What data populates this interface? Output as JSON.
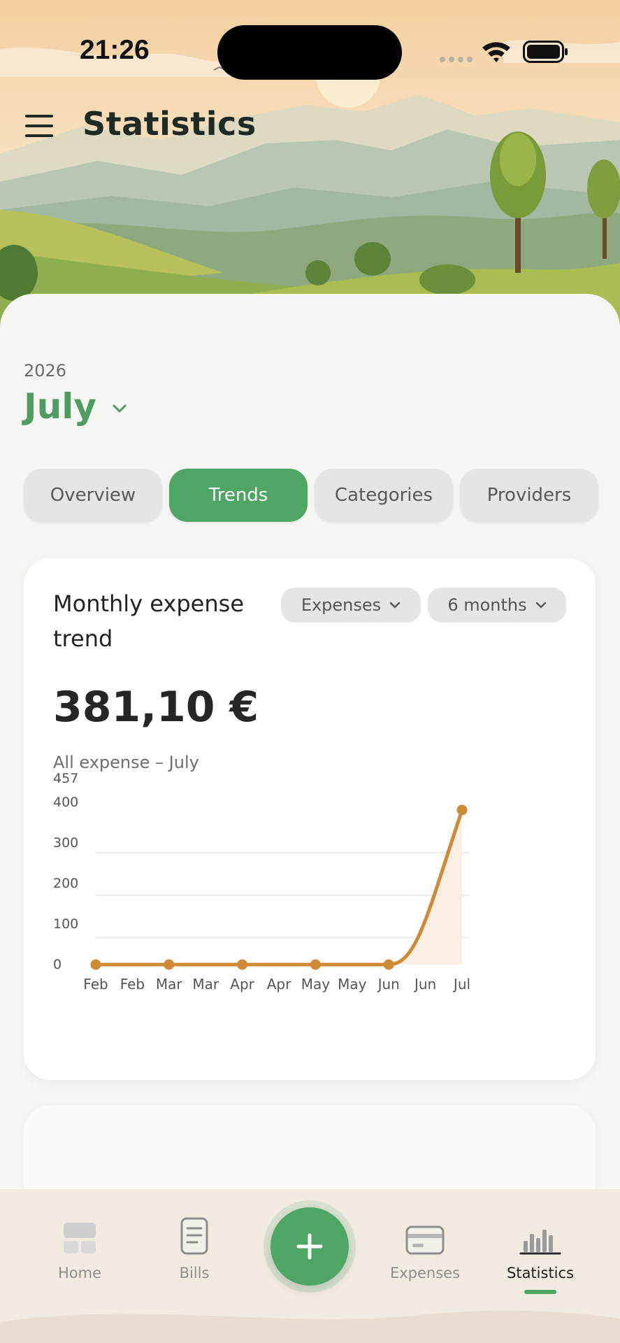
{
  "status_bar": {
    "time": "21:26"
  },
  "header": {
    "title": "Statistics"
  },
  "period": {
    "year": "2026",
    "month": "July"
  },
  "tabs": [
    {
      "label": "Overview",
      "active": false
    },
    {
      "label": "Trends",
      "active": true
    },
    {
      "label": "Categories",
      "active": false
    },
    {
      "label": "Providers",
      "active": false
    }
  ],
  "trend_card": {
    "title": "Monthly expense trend",
    "type_filter": "Expenses",
    "range_filter": "6 months",
    "amount": "381,10 €",
    "subtitle": "All expense – July"
  },
  "chart_data": {
    "type": "area",
    "title": "",
    "xlabel": "",
    "ylabel": "",
    "ylim": [
      0,
      457
    ],
    "yticks": [
      "457",
      "400",
      "300",
      "200",
      "100",
      "0"
    ],
    "x_tick_labels": [
      "Feb",
      "Feb",
      "Mar",
      "Mar",
      "Apr",
      "Apr",
      "May",
      "May",
      "Jun",
      "Jun",
      "Jul"
    ],
    "points": [
      {
        "x": "Feb",
        "y": 0
      },
      {
        "x": "Mar",
        "y": 0
      },
      {
        "x": "Apr",
        "y": 0
      },
      {
        "x": "May",
        "y": 0
      },
      {
        "x": "Jun",
        "y": 0
      },
      {
        "x": "Jul",
        "y": 381.1
      }
    ],
    "grid": true,
    "line_color": "#d08a36",
    "fill_color": "#fbeee2"
  },
  "bottom_nav": {
    "items": [
      {
        "label": "Home",
        "icon": "home-icon",
        "active": false
      },
      {
        "label": "Bills",
        "icon": "bills-icon",
        "active": false
      },
      {
        "label": "Expenses",
        "icon": "credit-card-icon",
        "active": false
      },
      {
        "label": "Statistics",
        "icon": "bar-chart-icon",
        "active": true
      }
    ],
    "fab_icon": "plus-icon"
  },
  "colors": {
    "accent": "#4ea665",
    "month_text": "#4f9c63",
    "chart_line": "#d08a36"
  }
}
